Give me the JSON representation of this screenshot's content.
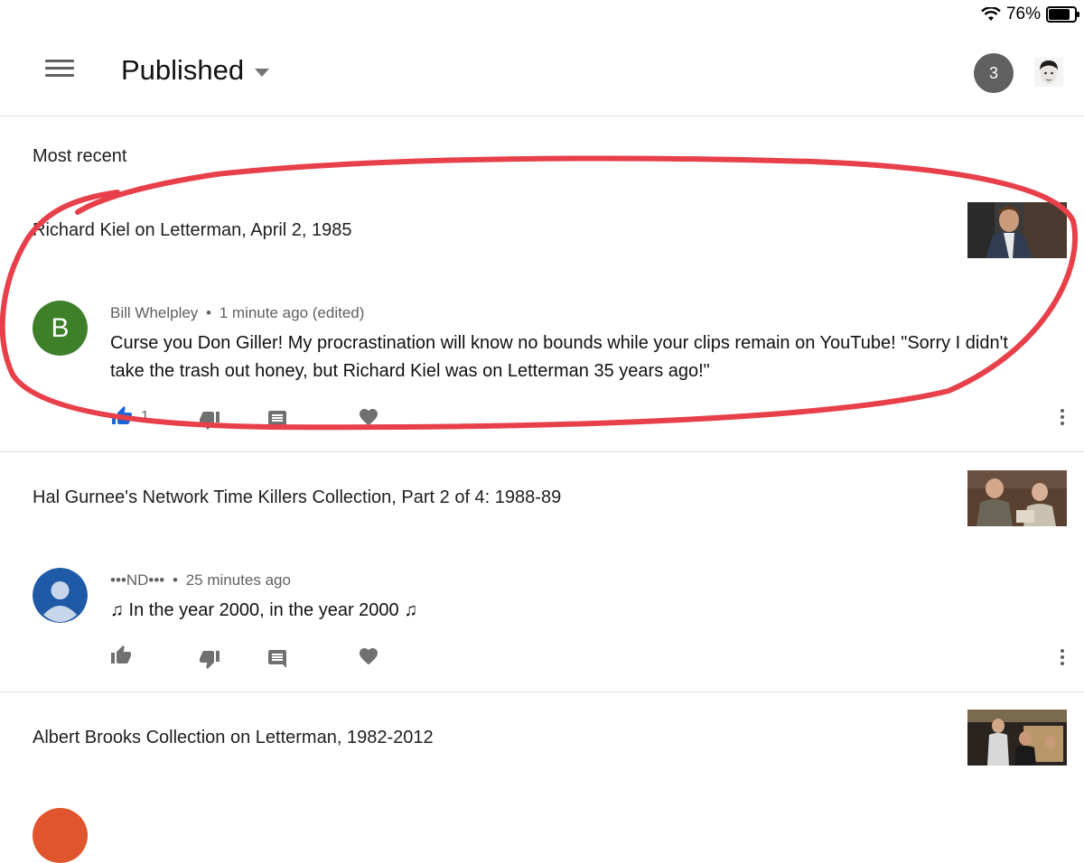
{
  "status_bar": {
    "battery": "76%"
  },
  "header": {
    "title": "Published",
    "notification_count": "3"
  },
  "section_label": "Most recent",
  "videos": [
    {
      "title": "Richard Kiel on Letterman, April 2, 1985",
      "comment": {
        "avatar_letter": "B",
        "avatar_color": "#3e7f2a",
        "author": "Bill Whelpley",
        "separator": "•",
        "time": "1 minute ago (edited)",
        "text": "Curse you Don Giller! My procrastination will know no bounds while your clips remain on YouTube! \"Sorry I didn't take the trash out  honey, but Richard Kiel was on Letterman 35 years ago!\"",
        "likes": "1",
        "liked": true
      }
    },
    {
      "title": "Hal Gurnee's Network Time Killers Collection, Part 2 of 4: 1988-89",
      "comment": {
        "avatar_color": "#1f5aa6",
        "author": "•••ND•••",
        "separator": "•",
        "time": "25 minutes ago",
        "text": "♫ In the year 2000, in the year 2000 ♫"
      }
    },
    {
      "title": "Albert Brooks Collection on Letterman, 1982-2012"
    }
  ],
  "colors": {
    "like_active": "#1a66d8",
    "icon_gray": "#707070",
    "annotation_red": "#e8404a"
  }
}
